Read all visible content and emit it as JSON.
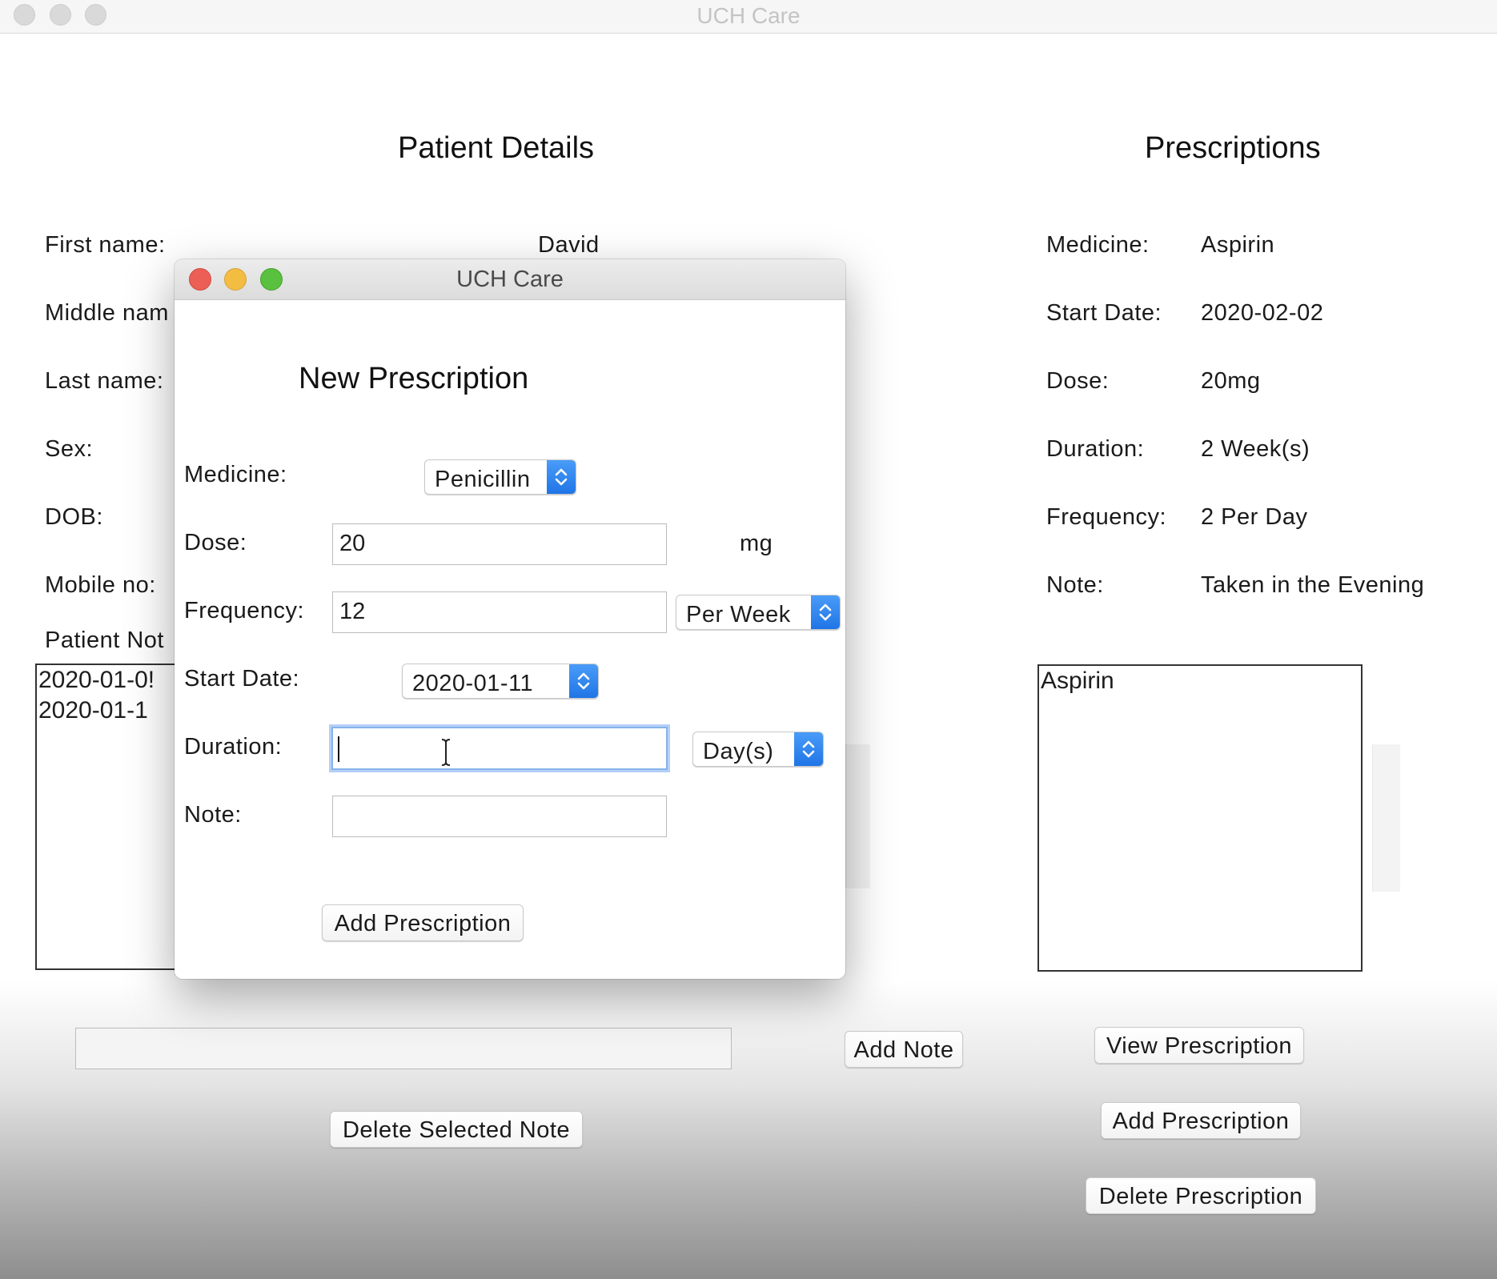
{
  "main_window": {
    "title": "UCH Care",
    "patient": {
      "heading": "Patient Details",
      "first_name_label": "First name:",
      "first_name_value": "David",
      "middle_name_label": "Middle nam",
      "last_name_label": "Last name:",
      "sex_label": "Sex:",
      "dob_label": "DOB:",
      "mobile_label": "Mobile no:",
      "notes_label": "Patient Not",
      "notes": [
        "2020-01-0!",
        "2020-01-1"
      ],
      "note_input_value": "",
      "add_note_button": "Add Note",
      "delete_note_button": "Delete Selected Note"
    },
    "prescriptions": {
      "heading": "Prescriptions",
      "medicine_label": "Medicine:",
      "medicine_value": "Aspirin",
      "start_date_label": "Start Date:",
      "start_date_value": "2020-02-02",
      "dose_label": "Dose:",
      "dose_value": "20mg",
      "duration_label": "Duration:",
      "duration_value": "2 Week(s)",
      "frequency_label": "Frequency:",
      "frequency_value": "2 Per Day",
      "note_label": "Note:",
      "note_value": "Taken in the Evening",
      "list": [
        "Aspirin"
      ],
      "view_button": "View Prescription",
      "add_button": "Add Prescription",
      "delete_button": "Delete Prescription"
    }
  },
  "dialog": {
    "title": "UCH Care",
    "heading": "New Prescription",
    "medicine_label": "Medicine:",
    "medicine_selected": "Penicillin",
    "dose_label": "Dose:",
    "dose_value": "20",
    "dose_unit": "mg",
    "frequency_label": "Frequency:",
    "frequency_value": "12",
    "frequency_period": "Per Week",
    "start_date_label": "Start Date:",
    "start_date_value": "2020-01-11",
    "duration_label": "Duration:",
    "duration_value": "",
    "duration_unit": "Day(s)",
    "note_label": "Note:",
    "note_value": "",
    "submit_button": "Add Prescription"
  },
  "icons": {
    "popup_arrows": "up-down-chevron-icon",
    "text_cursor": "ibeam-cursor-icon"
  },
  "colors": {
    "close": "#ec5f57",
    "minimize": "#f3bd41",
    "zoom": "#5ac03f",
    "accent": "#1f75e6"
  }
}
